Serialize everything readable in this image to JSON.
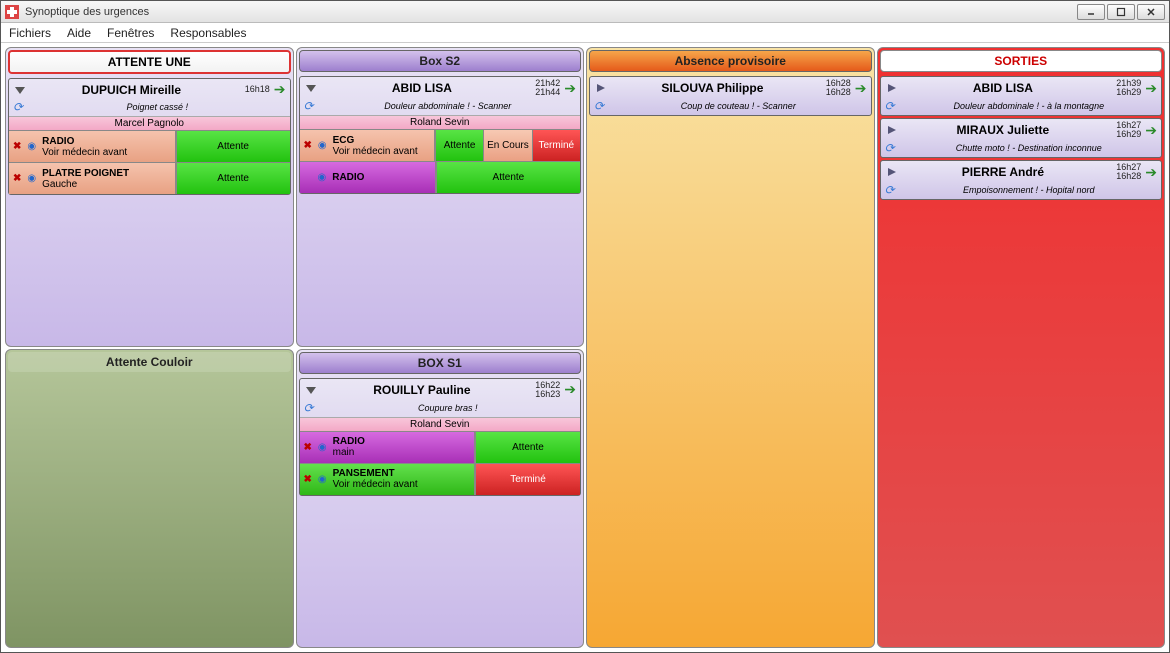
{
  "window": {
    "title": "Synoptique des urgences"
  },
  "menu": {
    "fichiers": "Fichiers",
    "aide": "Aide",
    "fenetres": "Fenêtres",
    "responsables": "Responsables"
  },
  "panels": {
    "attente_une": {
      "title": "ATTENTE UNE"
    },
    "box_s2": {
      "title": "Box S2"
    },
    "absence": {
      "title": "Absence provisoire"
    },
    "sorties": {
      "title": "SORTIES"
    },
    "couloir": {
      "title": "Attente Couloir"
    },
    "box_s1": {
      "title": "BOX S1"
    }
  },
  "patients": {
    "dupuich": {
      "name": "DUPUICH Mireille",
      "t1": "16h18",
      "diag": "Poignet cassé !",
      "doctor": "Marcel Pagnolo",
      "task1_name": "RADIO",
      "task1_note": "Voir médecin avant",
      "task1_status": "Attente",
      "task2_name": "PLATRE POIGNET",
      "task2_note": "Gauche",
      "task2_status": "Attente"
    },
    "abid": {
      "name": "ABID LISA",
      "t1": "21h42",
      "t2": "21h44",
      "diag": "Douleur abdominale ! - Scanner",
      "doctor": "Roland Sevin",
      "task1_name": "ECG",
      "task1_note": "Voir médecin avant",
      "task1_s1": "Attente",
      "task1_s2": "En Cours",
      "task1_s3": "Terminé",
      "task2_name": "RADIO",
      "task2_status": "Attente"
    },
    "silouva": {
      "name": "SILOUVA Philippe",
      "t1": "16h28",
      "t2": "16h28",
      "diag": "Coup de couteau ! - Scanner"
    },
    "abid_out": {
      "name": "ABID LISA",
      "t1": "21h39",
      "t2": "16h29",
      "diag": "Douleur abdominale ! - à la montagne"
    },
    "miraux": {
      "name": "MIRAUX Juliette",
      "t1": "16h27",
      "t2": "16h29",
      "diag": "Chutte moto ! - Destination inconnue"
    },
    "pierre": {
      "name": "PIERRE André",
      "t1": "16h27",
      "t2": "16h28",
      "diag": "Empoisonnement ! - Hopital nord"
    },
    "rouilly": {
      "name": "ROUILLY Pauline",
      "t1": "16h22",
      "t2": "16h23",
      "diag": "Coupure bras !",
      "doctor": "Roland Sevin",
      "task1_name": "RADIO",
      "task1_note": "main",
      "task1_status": "Attente",
      "task2_name": "PANSEMENT",
      "task2_note": "Voir médecin avant",
      "task2_status": "Terminé"
    }
  }
}
